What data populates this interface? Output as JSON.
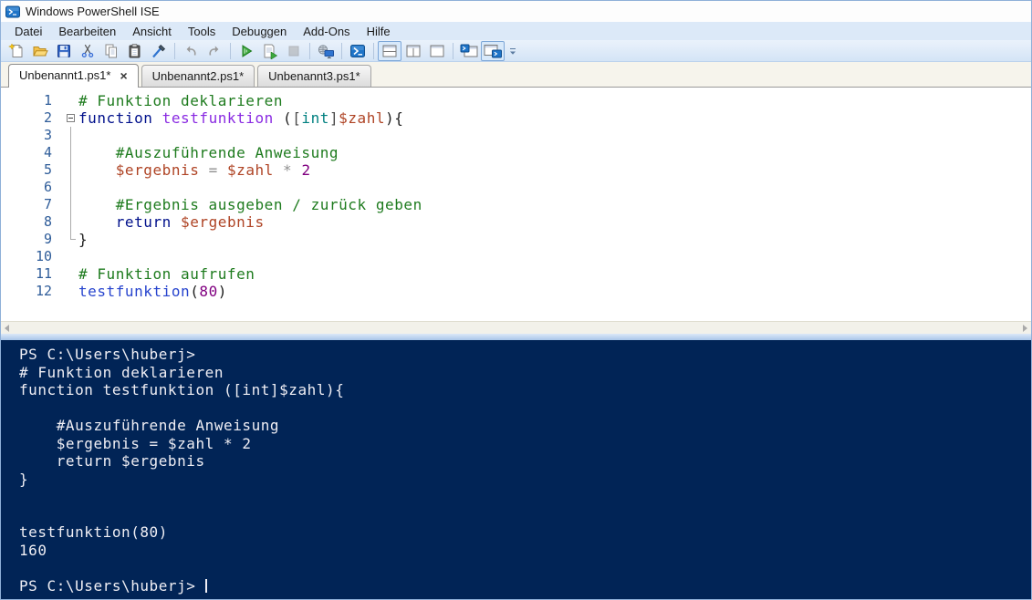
{
  "window": {
    "title": "Windows PowerShell ISE"
  },
  "menu": {
    "items": [
      {
        "id": "datei",
        "label": "Datei"
      },
      {
        "id": "bearbeiten",
        "label": "Bearbeiten"
      },
      {
        "id": "ansicht",
        "label": "Ansicht"
      },
      {
        "id": "tools",
        "label": "Tools"
      },
      {
        "id": "debuggen",
        "label": "Debuggen"
      },
      {
        "id": "add-ons",
        "label": "Add-Ons"
      },
      {
        "id": "hilfe",
        "label": "Hilfe"
      }
    ]
  },
  "toolbar": {
    "groups": [
      [
        {
          "id": "new-script"
        },
        {
          "id": "open-script"
        },
        {
          "id": "save-script"
        },
        {
          "id": "cut"
        },
        {
          "id": "copy"
        },
        {
          "id": "paste"
        },
        {
          "id": "clear-console-pane"
        }
      ],
      [
        {
          "id": "undo"
        },
        {
          "id": "redo"
        }
      ],
      [
        {
          "id": "run-script"
        },
        {
          "id": "run-selection"
        },
        {
          "id": "stop-operation",
          "disabled": true
        }
      ],
      [
        {
          "id": "new-remote-powershell-tab"
        }
      ],
      [
        {
          "id": "start-powershell-exe"
        }
      ],
      [
        {
          "id": "show-script-pane-top",
          "selected": true
        },
        {
          "id": "show-script-pane-right"
        },
        {
          "id": "show-script-pane-maximized"
        }
      ],
      [
        {
          "id": "new-powershell-tab"
        },
        {
          "id": "show-console-pane",
          "selected": true
        }
      ]
    ],
    "overflow_id": "toolbar-options"
  },
  "tabs": [
    {
      "id": "tab-1",
      "label": "Unbenannt1.ps1*",
      "active": true,
      "close_glyph": "×"
    },
    {
      "id": "tab-2",
      "label": "Unbenannt2.ps1*",
      "active": false
    },
    {
      "id": "tab-3",
      "label": "Unbenannt3.ps1*",
      "active": false
    }
  ],
  "editor": {
    "lines": [
      {
        "num": "1",
        "fold": "",
        "segs": [
          [
            "comment",
            "# Funktion deklarieren"
          ]
        ]
      },
      {
        "num": "2",
        "fold": "start",
        "segs": [
          [
            "keyword",
            "function"
          ],
          [
            "plain",
            " "
          ],
          [
            "function-name",
            "testfunktion"
          ],
          [
            "plain",
            " ("
          ],
          [
            "bracket",
            "["
          ],
          [
            "type",
            "int"
          ],
          [
            "bracket",
            "]"
          ],
          [
            "variable",
            "$zahl"
          ],
          [
            "plain",
            "){"
          ]
        ]
      },
      {
        "num": "3",
        "fold": "mid",
        "segs": []
      },
      {
        "num": "4",
        "fold": "mid",
        "segs": [
          [
            "comment",
            "    #Auszuführende Anweisung"
          ]
        ]
      },
      {
        "num": "5",
        "fold": "mid",
        "segs": [
          [
            "plain",
            "    "
          ],
          [
            "variable",
            "$ergebnis"
          ],
          [
            "operator",
            " = "
          ],
          [
            "variable",
            "$zahl"
          ],
          [
            "operator",
            " * "
          ],
          [
            "number",
            "2"
          ]
        ]
      },
      {
        "num": "6",
        "fold": "mid",
        "segs": []
      },
      {
        "num": "7",
        "fold": "mid",
        "segs": [
          [
            "comment",
            "    #Ergebnis ausgeben / zurück geben"
          ]
        ]
      },
      {
        "num": "8",
        "fold": "mid",
        "segs": [
          [
            "plain",
            "    "
          ],
          [
            "keyword",
            "return"
          ],
          [
            "plain",
            " "
          ],
          [
            "variable",
            "$ergebnis"
          ]
        ]
      },
      {
        "num": "9",
        "fold": "end",
        "segs": [
          [
            "plain",
            "}"
          ]
        ]
      },
      {
        "num": "10",
        "fold": "",
        "segs": []
      },
      {
        "num": "11",
        "fold": "",
        "segs": [
          [
            "comment",
            "# Funktion aufrufen"
          ]
        ]
      },
      {
        "num": "12",
        "fold": "",
        "segs": [
          [
            "command",
            "testfunktion"
          ],
          [
            "plain",
            "("
          ],
          [
            "number",
            "80"
          ],
          [
            "plain",
            ")"
          ]
        ]
      }
    ]
  },
  "syntax_colors": {
    "comment": "#1E7B1E",
    "keyword": "#00108B",
    "function-name": "#8A2BE2",
    "type": "#008080",
    "bracket": "#4A4A4A",
    "variable": "#AF4425",
    "operator": "#8F8F8F",
    "number": "#800080",
    "plain": "#1E1E1E",
    "command": "#2845CE",
    "linenum": "#2E5C99"
  },
  "console": {
    "background": "#012456",
    "text_color": "#EFEEF4",
    "lines": [
      "PS C:\\Users\\huberj>",
      "# Funktion deklarieren",
      "function testfunktion ([int]$zahl){",
      "",
      "    #Auszuführende Anweisung",
      "    $ergebnis = $zahl * 2",
      "    return $ergebnis",
      "}",
      "",
      "",
      "testfunktion(80)",
      "160",
      "",
      "PS C:\\Users\\huberj> "
    ],
    "cursor_on_last_line": true
  }
}
